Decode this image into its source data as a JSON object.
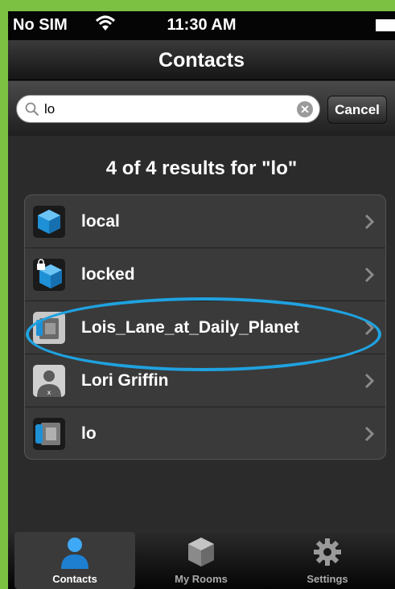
{
  "status_bar": {
    "carrier": "No SIM",
    "time": "11:30 AM"
  },
  "nav_bar": {
    "title": "Contacts"
  },
  "search": {
    "value": "lo",
    "cancel_label": "Cancel"
  },
  "results": {
    "heading": "4 of 4 results for \"lo\"",
    "items": [
      {
        "label": "local",
        "icon": "room-cube-icon"
      },
      {
        "label": "locked",
        "icon": "locked-room-icon"
      },
      {
        "label": "Lois_Lane_at_Daily_Planet",
        "icon": "endpoint-device-icon"
      },
      {
        "label": "Lori Griffin",
        "icon": "user-icon"
      },
      {
        "label": "lo",
        "icon": "phone-icon"
      }
    ]
  },
  "tab_bar": {
    "tabs": [
      {
        "label": "Contacts",
        "icon": "contacts-icon",
        "selected": true
      },
      {
        "label": "My Rooms",
        "icon": "rooms-icon",
        "selected": false
      },
      {
        "label": "Settings",
        "icon": "gear-icon",
        "selected": false
      }
    ]
  },
  "colors": {
    "frame": "#7cc142",
    "highlight": "#1fa2e0",
    "accent_blue": "#1e90d6"
  }
}
